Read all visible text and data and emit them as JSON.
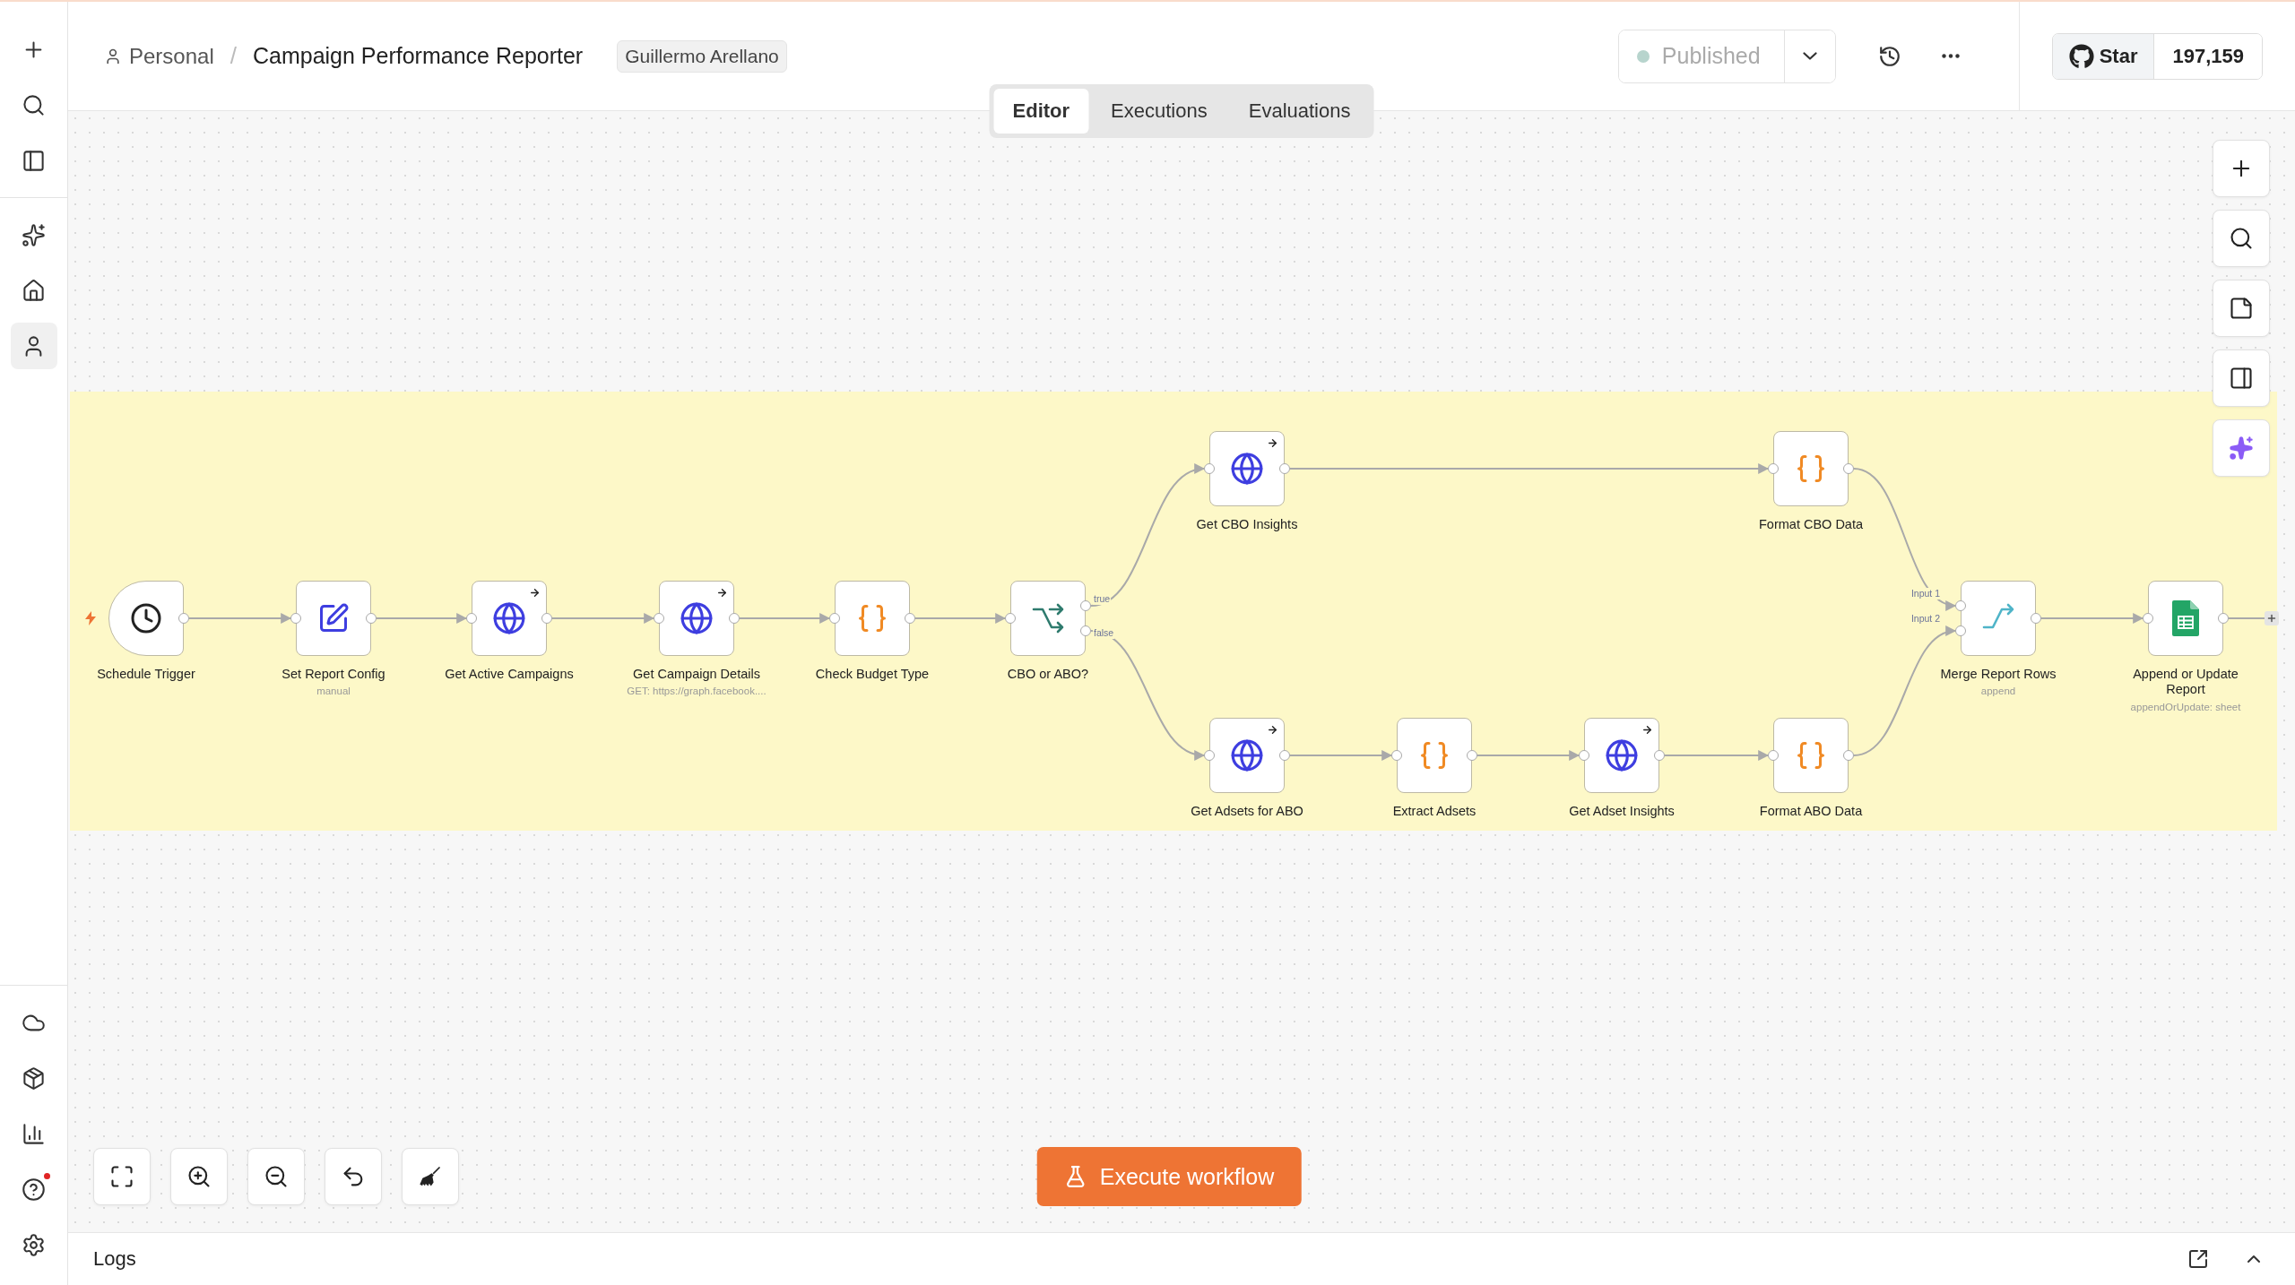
{
  "sidebar": {
    "items": [
      {
        "kind": "create",
        "selected": false
      },
      {
        "kind": "search",
        "selected": false
      },
      {
        "kind": "panel",
        "selected": false
      },
      {
        "kind": "divider"
      },
      {
        "kind": "ai",
        "selected": false
      },
      {
        "kind": "home",
        "selected": false
      },
      {
        "kind": "personal",
        "selected": true
      },
      {
        "kind": "spacer"
      },
      {
        "kind": "cloud",
        "selected": false
      },
      {
        "kind": "templates",
        "selected": false
      },
      {
        "kind": "insights",
        "selected": false
      },
      {
        "kind": "help",
        "selected": false,
        "notification": true
      },
      {
        "kind": "settings",
        "selected": false
      }
    ]
  },
  "header": {
    "project": "Personal",
    "separator": "/",
    "workflow_name": "Campaign Performance Reporter",
    "tag": "Guillermo Arellano",
    "publish_button": "Published",
    "github": {
      "label": "Star",
      "count": "197,159"
    }
  },
  "tabs": [
    {
      "label": "Editor",
      "selected": true
    },
    {
      "label": "Executions",
      "selected": false
    },
    {
      "label": "Evaluations",
      "selected": false
    }
  ],
  "nodes": [
    {
      "name": "Schedule Trigger",
      "kind": "trigger"
    },
    {
      "name": "Set Report Config",
      "kind": "set",
      "subtitle": "manual"
    },
    {
      "name": "Get Active Campaigns",
      "kind": "http"
    },
    {
      "name": "Get Campaign Details",
      "kind": "http",
      "subtitle": "GET: https://graph.facebook...."
    },
    {
      "name": "Check Budget Type",
      "kind": "code"
    },
    {
      "name": "CBO or ABO?",
      "kind": "if",
      "outputs": [
        "true",
        "false"
      ]
    },
    {
      "name": "Get CBO Insights",
      "kind": "http"
    },
    {
      "name": "Format CBO Data",
      "kind": "code"
    },
    {
      "name": "Get Adsets for ABO",
      "kind": "http"
    },
    {
      "name": "Extract Adsets",
      "kind": "code"
    },
    {
      "name": "Get Adset Insights",
      "kind": "http"
    },
    {
      "name": "Format ABO Data",
      "kind": "code"
    },
    {
      "name": "Merge Report Rows",
      "kind": "merge",
      "subtitle": "append",
      "inputs": [
        "Input 1",
        "Input 2"
      ]
    },
    {
      "name": "Append or Update Report",
      "kind": "sheets",
      "subtitle": "appendOrUpdate: sheet"
    }
  ],
  "canvas_controls": [
    {
      "kind": "add"
    },
    {
      "kind": "search"
    },
    {
      "kind": "sticky"
    },
    {
      "kind": "panel"
    },
    {
      "kind": "ai"
    }
  ],
  "zoom_controls": [
    {
      "kind": "fit"
    },
    {
      "kind": "zoom_in"
    },
    {
      "kind": "zoom_out"
    },
    {
      "kind": "undo"
    },
    {
      "kind": "tidy"
    }
  ],
  "execute_button": "Execute workflow",
  "logs": {
    "title": "Logs"
  }
}
